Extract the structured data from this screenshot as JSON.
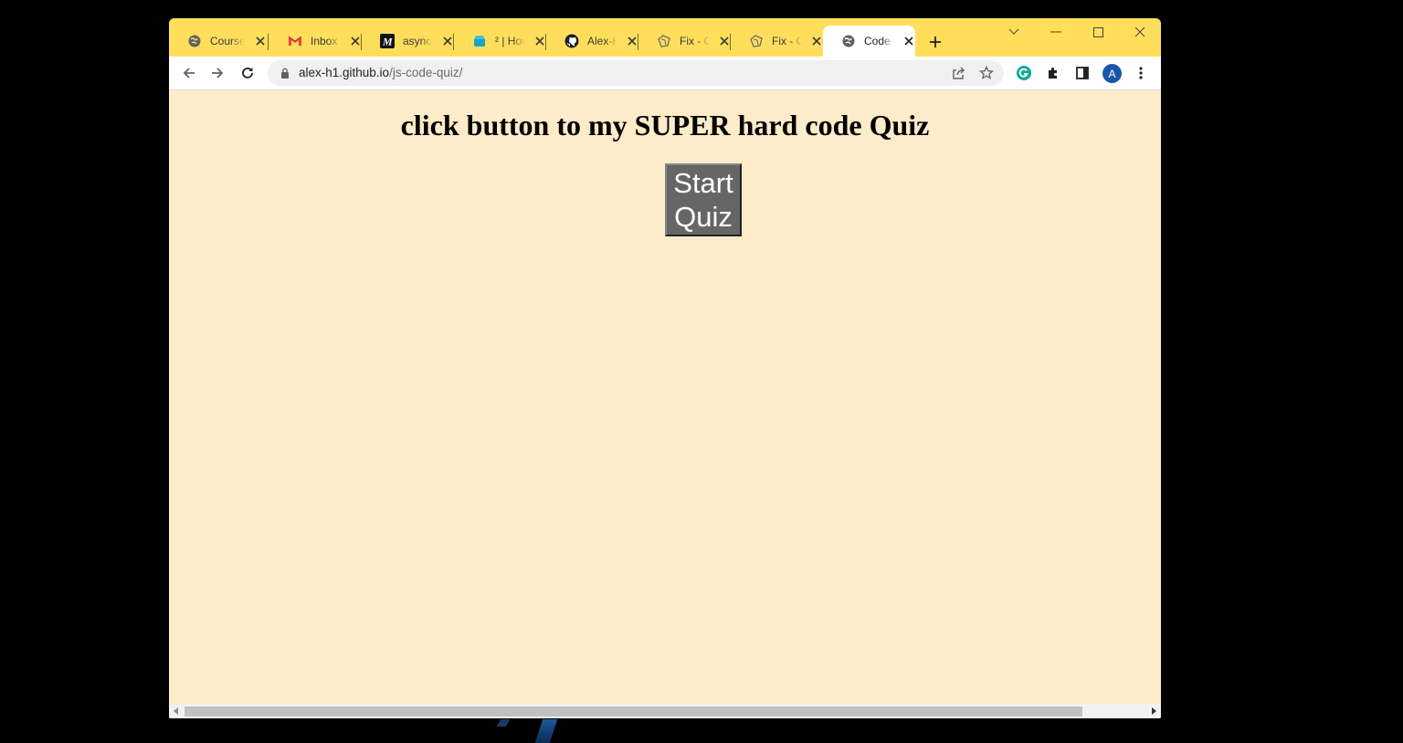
{
  "browser": {
    "tabs": [
      {
        "title": "Course",
        "icon": "globe-icon"
      },
      {
        "title": "Inbox (",
        "icon": "gmail-icon"
      },
      {
        "title": "async f",
        "icon": "medium-icon"
      },
      {
        "title": "² | How",
        "icon": "stackoverflow-icon"
      },
      {
        "title": "Alex-H",
        "icon": "github-icon"
      },
      {
        "title": "Fix - Ca",
        "icon": "puzzle-app-icon"
      },
      {
        "title": "Fix - Ca",
        "icon": "puzzle-app-icon"
      },
      {
        "title": "Code C",
        "icon": "globe-icon",
        "active": true
      }
    ],
    "address": {
      "host": "alex-h1.github.io",
      "path": "/js-code-quiz/"
    },
    "profile_initial": "A",
    "colors": {
      "tabstrip": "#ffde5c",
      "page_bg": "#fdebc9",
      "button_bg": "#666666",
      "profile": "#1a56a8"
    }
  },
  "page": {
    "title": "click button to my SUPER hard code Quiz",
    "start_button": "Start Quiz"
  }
}
